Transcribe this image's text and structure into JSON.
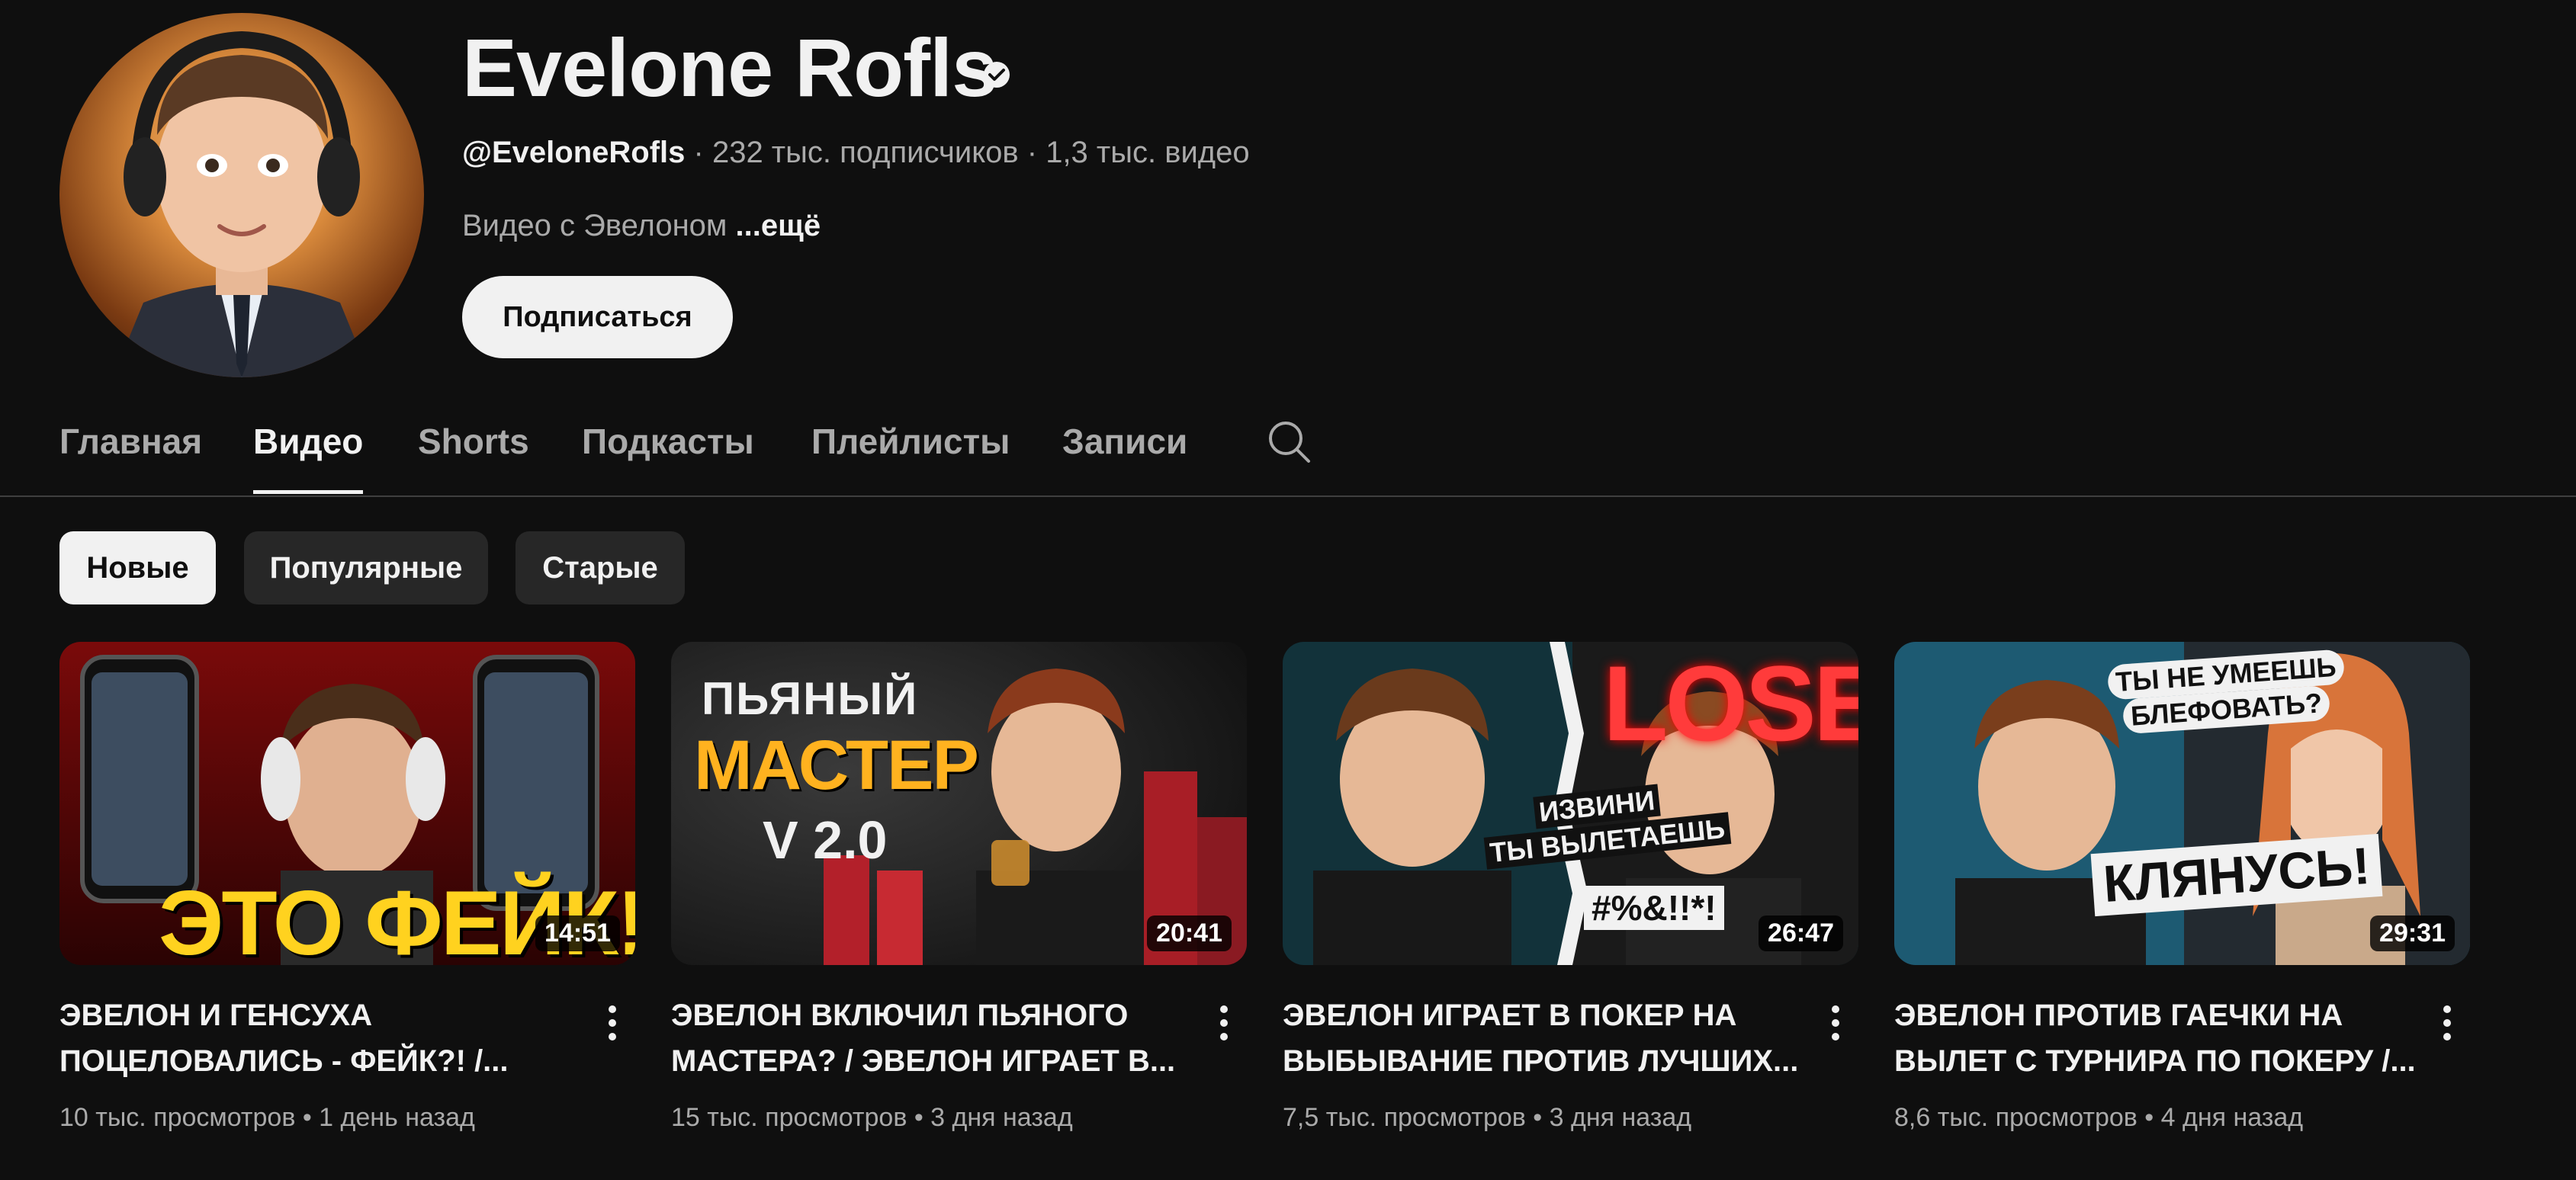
{
  "channel": {
    "name": "Evelone Rofls",
    "handle": "@EveloneRofls",
    "stats": " · 232 тыс. подписчиков · 1,3 тыс. видео",
    "description": "Видео с Эвелоном ",
    "more": "...ещё",
    "subscribe_label": "Подписаться"
  },
  "tabs": [
    {
      "label": "Главная"
    },
    {
      "label": "Видео"
    },
    {
      "label": "Shorts"
    },
    {
      "label": "Подкасты"
    },
    {
      "label": "Плейлисты"
    },
    {
      "label": "Записи"
    }
  ],
  "chips": [
    {
      "label": "Новые"
    },
    {
      "label": "Популярные"
    },
    {
      "label": "Старые"
    }
  ],
  "videos": [
    {
      "title_line1": "ЭВЕЛОН И ГЕНСУХА",
      "title_line2": "ПОЦЕЛОВАЛИСЬ - ФЕЙК?! /...",
      "duration": "14:51",
      "meta": "10 тыс. просмотров • 1 день назад",
      "thumb_text": "ЭТО ФЕЙК!"
    },
    {
      "title_line1": "ЭВЕЛОН ВКЛЮЧИЛ ПЬЯНОГО",
      "title_line2": "МАСТЕРА? / ЭВЕЛОН ИГРАЕТ В...",
      "duration": "20:41",
      "meta": "15 тыс. просмотров • 3 дня назад",
      "thumb_text_1": "ПЬЯНЫЙ",
      "thumb_text_2": "МАСТЕР",
      "thumb_text_3": "V 2.0"
    },
    {
      "title_line1": "ЭВЕЛОН ИГРАЕТ В ПОКЕР НА",
      "title_line2": "ВЫБЫВАНИЕ ПРОТИВ ЛУЧШИХ...",
      "duration": "26:47",
      "meta": "7,5 тыс. просмотров • 3 дня назад",
      "thumb_text_1": "LOSE",
      "thumb_text_2": "ИЗВИНИ",
      "thumb_text_3": "ТЫ ВЫЛЕТАЕШЬ",
      "thumb_text_4": "#%&!!*!"
    },
    {
      "title_line1": "ЭВЕЛОН ПРОТИВ ГАЕЧКИ НА",
      "title_line2": "ВЫЛЕТ С ТУРНИРА ПО ПОКЕРУ /...",
      "duration": "29:31",
      "meta": "8,6 тыс. просмотров • 4 дня назад",
      "thumb_text_1": "ТЫ НЕ УМЕЕШЬ",
      "thumb_text_2": "БЛЕФОВАТЬ?",
      "thumb_text_3": "КЛЯНУСЬ!"
    }
  ]
}
